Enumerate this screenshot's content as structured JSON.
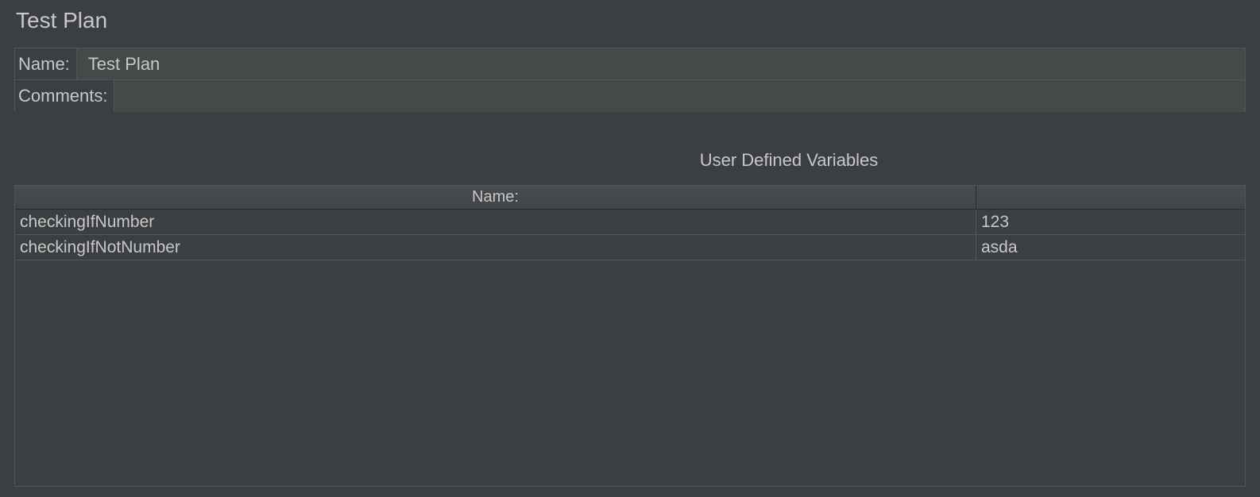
{
  "page": {
    "title": "Test Plan"
  },
  "form": {
    "name_label": "Name:",
    "name_value": "Test Plan",
    "comments_label": "Comments:",
    "comments_value": ""
  },
  "variables_section": {
    "title": "User Defined Variables",
    "columns": {
      "name": "Name:",
      "value": ""
    },
    "rows": [
      {
        "name": "checkingIfNumber",
        "value": "123"
      },
      {
        "name": "checkingIfNotNumber",
        "value": "asda"
      }
    ]
  }
}
